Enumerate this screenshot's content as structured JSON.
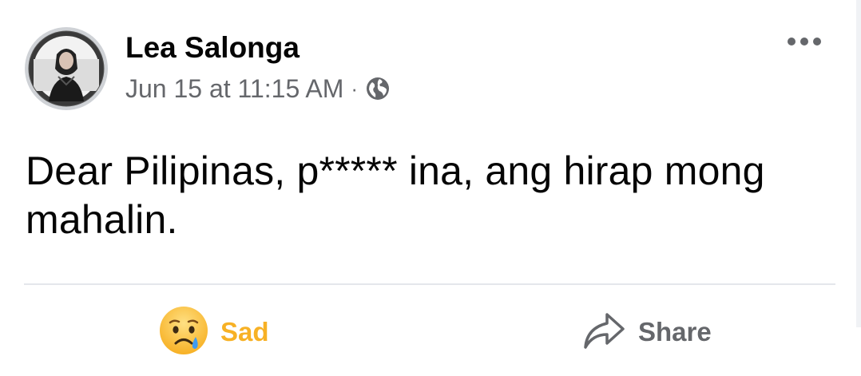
{
  "post": {
    "author": "Lea Salonga",
    "timestamp": "Jun 15 at 11:15 AM",
    "separator": "·",
    "privacy_icon": "globe-icon",
    "more_icon": "more-horizontal-icon",
    "text": "Dear Pilipinas, p***** ina, ang hirap mong mahalin."
  },
  "actions": {
    "reaction_label": "Sad",
    "reaction_icon": "sad-emoji-icon",
    "share_label": "Share",
    "share_icon": "share-arrow-icon"
  },
  "colors": {
    "sad": "#f7b125",
    "muted": "#65676b",
    "text": "#050505",
    "divider": "#e4e6eb"
  }
}
